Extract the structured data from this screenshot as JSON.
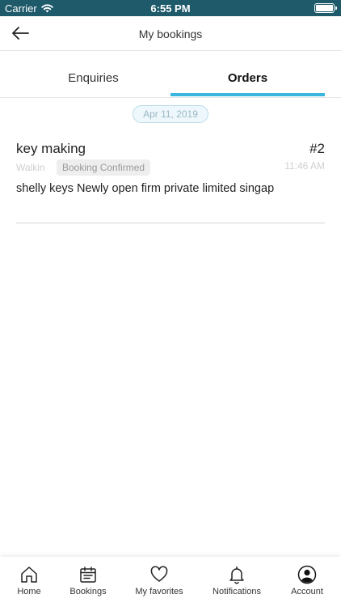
{
  "status_bar": {
    "carrier": "Carrier",
    "time": "6:55 PM"
  },
  "nav": {
    "title": "My bookings",
    "back_icon": "arrow-left-icon"
  },
  "tabs": [
    {
      "label": "Enquiries",
      "active": false
    },
    {
      "label": "Orders",
      "active": true
    }
  ],
  "date_separator": "Apr 11, 2019",
  "orders": [
    {
      "service": "key making",
      "order_number": "#2",
      "type": "Walkin",
      "status": "Booking Confirmed",
      "time": "11:46 AM",
      "address": "shelly keys Newly open firm private limited singap"
    }
  ],
  "tab_bar": [
    {
      "label": "Home",
      "icon": "home-icon"
    },
    {
      "label": "Bookings",
      "icon": "calendar-icon"
    },
    {
      "label": "My favorites",
      "icon": "heart-icon"
    },
    {
      "label": "Notifications",
      "icon": "bell-icon"
    },
    {
      "label": "Account",
      "icon": "user-icon"
    }
  ],
  "colors": {
    "status_bar": "#1e5a6a",
    "accent": "#3bb7df",
    "muted_text": "#cfcfcf"
  }
}
